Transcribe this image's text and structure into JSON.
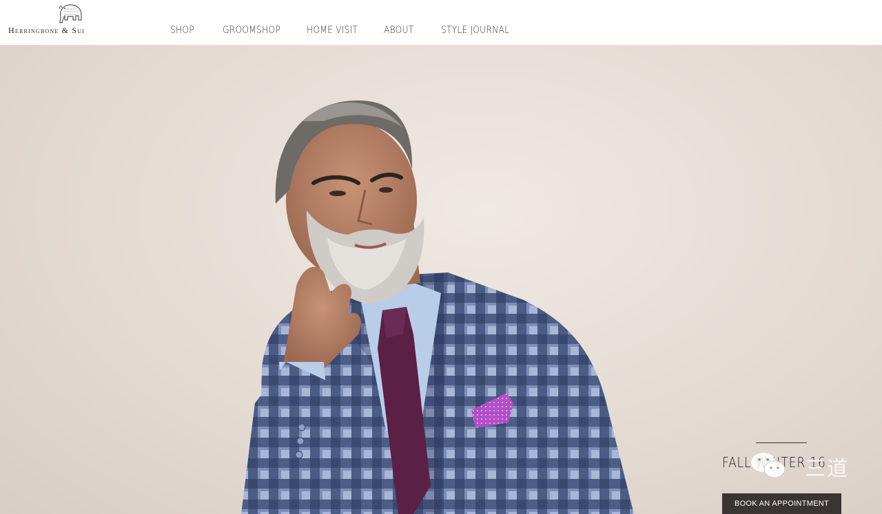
{
  "brand": {
    "name": "Herringbone & Sui",
    "logo_icon": "elephant-icon"
  },
  "nav": {
    "items": [
      {
        "label": "SHOP"
      },
      {
        "label": "GROOMSHOP"
      },
      {
        "label": "HOME VISIT"
      },
      {
        "label": "ABOUT"
      },
      {
        "label": "STYLE JOURNAL"
      }
    ]
  },
  "hero": {
    "image": "bearded-man-plaid-suit-photo",
    "promo_title": "FALL WINTER 16",
    "cta_label": "BOOK AN APPOINTMENT"
  },
  "watermark": {
    "icon": "wechat-icon",
    "text": "三道"
  },
  "colors": {
    "header_bg": "#ffffff",
    "hero_bg": "#e6ddd5",
    "cta_bg": "#3a3433",
    "text": "#333333"
  }
}
